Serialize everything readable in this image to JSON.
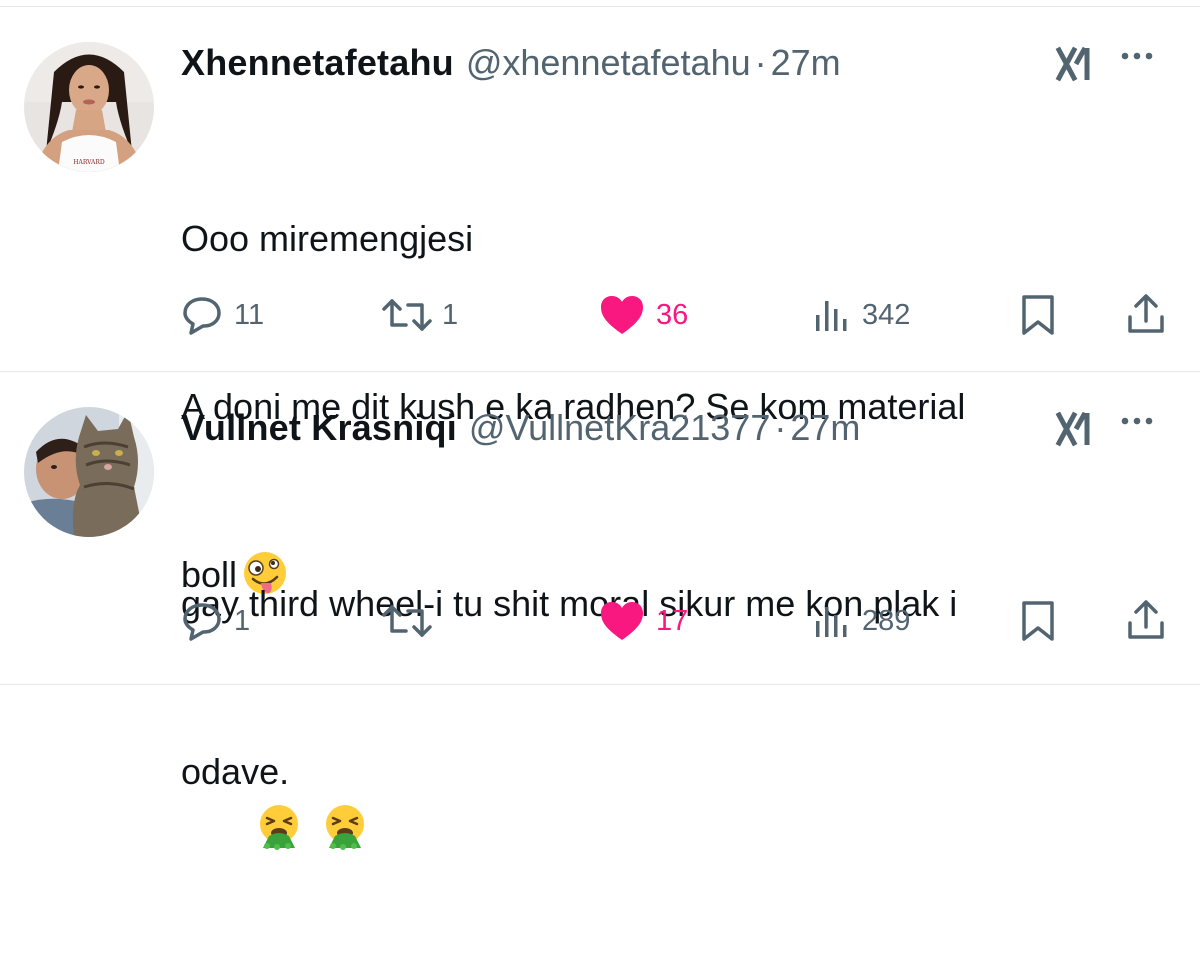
{
  "tweets": [
    {
      "display_name": "Xhennetafetahu",
      "handle": "@xhennetafetahu",
      "separator": "·",
      "time": "27m",
      "text_lines": [
        "Ooo miremengjesi",
        "A doni me dit kush e ka radhen? Se kom material",
        "boll"
      ],
      "emojis": [
        "zany-face-emoji"
      ],
      "avatar_text": "HARVARD",
      "replies": "11",
      "reposts": "1",
      "likes": "36",
      "liked": true,
      "views": "342"
    },
    {
      "display_name": "Vullnet Krasniqi",
      "handle": "@VullnetKra21377",
      "separator": "·",
      "time": "27m",
      "text_lines": [
        "gay third wheel-i tu shit moral sikur me kon plak i",
        "odave."
      ],
      "emojis": [
        "vomiting-face-emoji",
        "vomiting-face-emoji"
      ],
      "replies": "1",
      "reposts": "",
      "likes": "17",
      "liked": true,
      "views": "289"
    }
  ],
  "colors": {
    "text": "#0f1419",
    "secondary": "#536471",
    "like": "#f91880",
    "divider": "#e6e8ea"
  },
  "icons": [
    "reply-icon",
    "repost-icon",
    "heart-icon",
    "views-icon",
    "bookmark-icon",
    "share-icon",
    "grok-icon",
    "more-icon"
  ]
}
